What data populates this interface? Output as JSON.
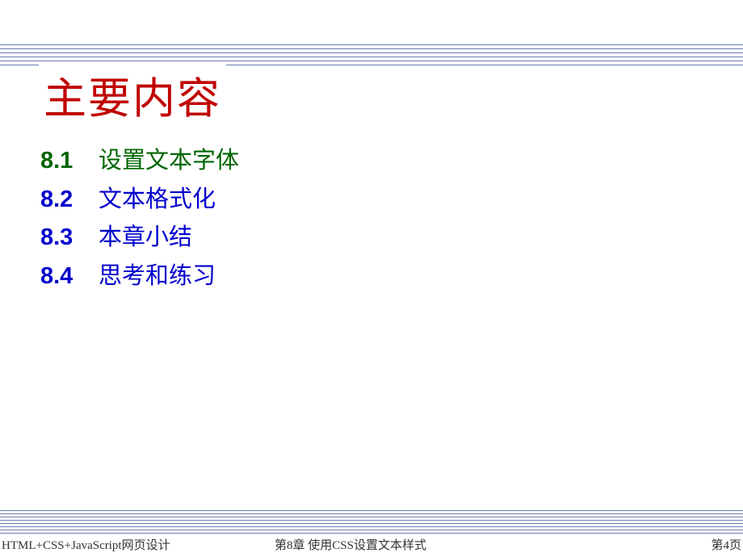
{
  "title": "主要内容",
  "toc": [
    {
      "num": "8.1",
      "text": "设置文本字体",
      "color": "green"
    },
    {
      "num": "8.2",
      "text": "文本格式化",
      "color": "blue"
    },
    {
      "num": "8.3",
      "text": "本章小结",
      "color": "blue"
    },
    {
      "num": "8.4",
      "text": "思考和练习",
      "color": "blue"
    }
  ],
  "footer": {
    "left": "HTML+CSS+JavaScript网页设计",
    "center": "第8章    使用CSS设置文本样式",
    "right": "第4页"
  }
}
